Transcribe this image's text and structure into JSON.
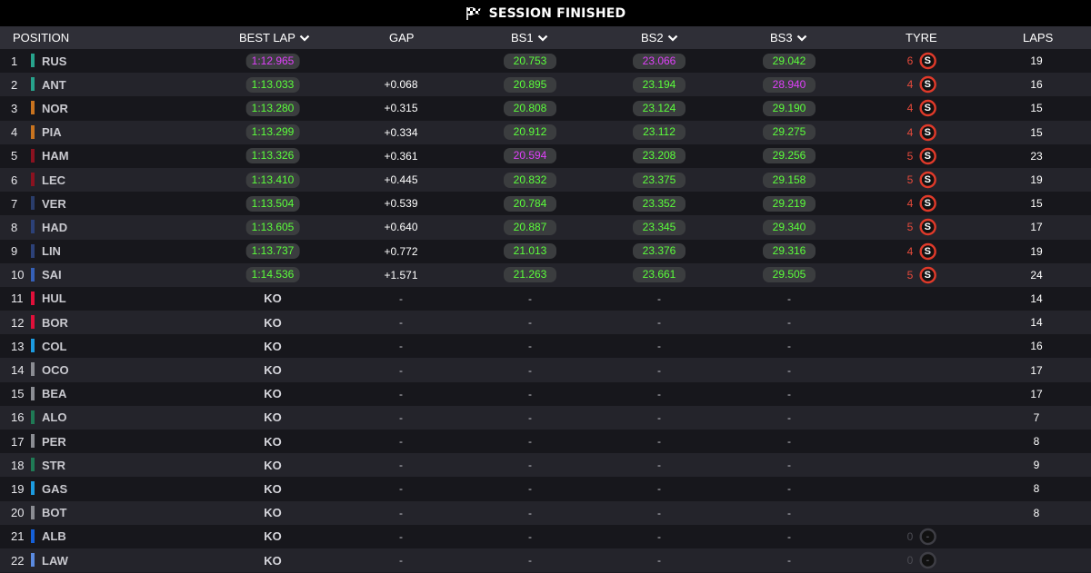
{
  "topbar": {
    "title": "SESSION FINISHED",
    "icon": "checkered-flag-icon"
  },
  "headers": {
    "position": "POSITION",
    "best_lap": "BEST LAP",
    "gap": "GAP",
    "bs1": "BS1",
    "bs2": "BS2",
    "bs3": "BS3",
    "tyre": "TYRE",
    "laps": "LAPS"
  },
  "colors": {
    "green_time": "#5bff3b",
    "purple_time": "#e040fb",
    "soft_tyre": "#e74a3b"
  },
  "rows": [
    {
      "pos": "1",
      "driver": "RUS",
      "team_color": "#27a38c",
      "best": "1:12.965",
      "best_c": "purple",
      "gap": "",
      "bs1": "20.753",
      "bs1_c": "green",
      "bs2": "23.066",
      "bs2_c": "purple",
      "bs3": "29.042",
      "bs3_c": "green",
      "tyre_laps": "6",
      "tyre": "S",
      "laps": "19"
    },
    {
      "pos": "2",
      "driver": "ANT",
      "team_color": "#27a38c",
      "best": "1:13.033",
      "best_c": "green",
      "gap": "+0.068",
      "bs1": "20.895",
      "bs1_c": "green",
      "bs2": "23.194",
      "bs2_c": "green",
      "bs3": "28.940",
      "bs3_c": "purple",
      "tyre_laps": "4",
      "tyre": "S",
      "laps": "16"
    },
    {
      "pos": "3",
      "driver": "NOR",
      "team_color": "#c8731f",
      "best": "1:13.280",
      "best_c": "green",
      "gap": "+0.315",
      "bs1": "20.808",
      "bs1_c": "green",
      "bs2": "23.124",
      "bs2_c": "green",
      "bs3": "29.190",
      "bs3_c": "green",
      "tyre_laps": "4",
      "tyre": "S",
      "laps": "15"
    },
    {
      "pos": "4",
      "driver": "PIA",
      "team_color": "#c8731f",
      "best": "1:13.299",
      "best_c": "green",
      "gap": "+0.334",
      "bs1": "20.912",
      "bs1_c": "green",
      "bs2": "23.112",
      "bs2_c": "green",
      "bs3": "29.275",
      "bs3_c": "green",
      "tyre_laps": "4",
      "tyre": "S",
      "laps": "15"
    },
    {
      "pos": "5",
      "driver": "HAM",
      "team_color": "#8a1220",
      "best": "1:13.326",
      "best_c": "green",
      "gap": "+0.361",
      "bs1": "20.594",
      "bs1_c": "purple",
      "bs2": "23.208",
      "bs2_c": "green",
      "bs3": "29.256",
      "bs3_c": "green",
      "tyre_laps": "5",
      "tyre": "S",
      "laps": "23"
    },
    {
      "pos": "6",
      "driver": "LEC",
      "team_color": "#8a1220",
      "best": "1:13.410",
      "best_c": "green",
      "gap": "+0.445",
      "bs1": "20.832",
      "bs1_c": "green",
      "bs2": "23.375",
      "bs2_c": "green",
      "bs3": "29.158",
      "bs3_c": "green",
      "tyre_laps": "5",
      "tyre": "S",
      "laps": "19"
    },
    {
      "pos": "7",
      "driver": "VER",
      "team_color": "#2a3d6b",
      "best": "1:13.504",
      "best_c": "green",
      "gap": "+0.539",
      "bs1": "20.784",
      "bs1_c": "green",
      "bs2": "23.352",
      "bs2_c": "green",
      "bs3": "29.219",
      "bs3_c": "green",
      "tyre_laps": "4",
      "tyre": "S",
      "laps": "15"
    },
    {
      "pos": "8",
      "driver": "HAD",
      "team_color": "#2c4178",
      "best": "1:13.605",
      "best_c": "green",
      "gap": "+0.640",
      "bs1": "20.887",
      "bs1_c": "green",
      "bs2": "23.345",
      "bs2_c": "green",
      "bs3": "29.340",
      "bs3_c": "green",
      "tyre_laps": "5",
      "tyre": "S",
      "laps": "17"
    },
    {
      "pos": "9",
      "driver": "LIN",
      "team_color": "#2c4178",
      "best": "1:13.737",
      "best_c": "green",
      "gap": "+0.772",
      "bs1": "21.013",
      "bs1_c": "green",
      "bs2": "23.376",
      "bs2_c": "green",
      "bs3": "29.316",
      "bs3_c": "green",
      "tyre_laps": "4",
      "tyre": "S",
      "laps": "19"
    },
    {
      "pos": "10",
      "driver": "SAI",
      "team_color": "#3560b8",
      "best": "1:14.536",
      "best_c": "green",
      "gap": "+1.571",
      "bs1": "21.263",
      "bs1_c": "green",
      "bs2": "23.661",
      "bs2_c": "green",
      "bs3": "29.505",
      "bs3_c": "green",
      "tyre_laps": "5",
      "tyre": "S",
      "laps": "24"
    },
    {
      "pos": "11",
      "driver": "HUL",
      "team_color": "#e0103a",
      "best": "KO",
      "gap": "-",
      "bs1": "-",
      "bs2": "-",
      "bs3": "-",
      "tyre_laps": "",
      "tyre": "",
      "laps": "14"
    },
    {
      "pos": "12",
      "driver": "BOR",
      "team_color": "#e0103a",
      "best": "KO",
      "gap": "-",
      "bs1": "-",
      "bs2": "-",
      "bs3": "-",
      "tyre_laps": "",
      "tyre": "",
      "laps": "14"
    },
    {
      "pos": "13",
      "driver": "COL",
      "team_color": "#1c9be0",
      "best": "KO",
      "gap": "-",
      "bs1": "-",
      "bs2": "-",
      "bs3": "-",
      "tyre_laps": "",
      "tyre": "",
      "laps": "16"
    },
    {
      "pos": "14",
      "driver": "OCO",
      "team_color": "#8b8d93",
      "best": "KO",
      "gap": "-",
      "bs1": "-",
      "bs2": "-",
      "bs3": "-",
      "tyre_laps": "",
      "tyre": "",
      "laps": "17"
    },
    {
      "pos": "15",
      "driver": "BEA",
      "team_color": "#8b8d93",
      "best": "KO",
      "gap": "-",
      "bs1": "-",
      "bs2": "-",
      "bs3": "-",
      "tyre_laps": "",
      "tyre": "",
      "laps": "17"
    },
    {
      "pos": "16",
      "driver": "ALO",
      "team_color": "#1f7a55",
      "best": "KO",
      "gap": "-",
      "bs1": "-",
      "bs2": "-",
      "bs3": "-",
      "tyre_laps": "",
      "tyre": "",
      "laps": "7"
    },
    {
      "pos": "17",
      "driver": "PER",
      "team_color": "#8b8d93",
      "best": "KO",
      "gap": "-",
      "bs1": "-",
      "bs2": "-",
      "bs3": "-",
      "tyre_laps": "",
      "tyre": "",
      "laps": "8"
    },
    {
      "pos": "18",
      "driver": "STR",
      "team_color": "#1f7a55",
      "best": "KO",
      "gap": "-",
      "bs1": "-",
      "bs2": "-",
      "bs3": "-",
      "tyre_laps": "",
      "tyre": "",
      "laps": "9"
    },
    {
      "pos": "19",
      "driver": "GAS",
      "team_color": "#1c9be0",
      "best": "KO",
      "gap": "-",
      "bs1": "-",
      "bs2": "-",
      "bs3": "-",
      "tyre_laps": "",
      "tyre": "",
      "laps": "8"
    },
    {
      "pos": "20",
      "driver": "BOT",
      "team_color": "#8b8d93",
      "best": "KO",
      "gap": "-",
      "bs1": "-",
      "bs2": "-",
      "bs3": "-",
      "tyre_laps": "",
      "tyre": "",
      "laps": "8"
    },
    {
      "pos": "21",
      "driver": "ALB",
      "team_color": "#1560d8",
      "best": "KO",
      "gap": "-",
      "bs1": "-",
      "bs2": "-",
      "bs3": "-",
      "tyre_laps": "0",
      "tyre": "-",
      "tyre_dim": true,
      "laps": ""
    },
    {
      "pos": "22",
      "driver": "LAW",
      "team_color": "#5a8ae0",
      "best": "KO",
      "gap": "-",
      "bs1": "-",
      "bs2": "-",
      "bs3": "-",
      "tyre_laps": "0",
      "tyre": "-",
      "tyre_dim": true,
      "laps": ""
    }
  ]
}
